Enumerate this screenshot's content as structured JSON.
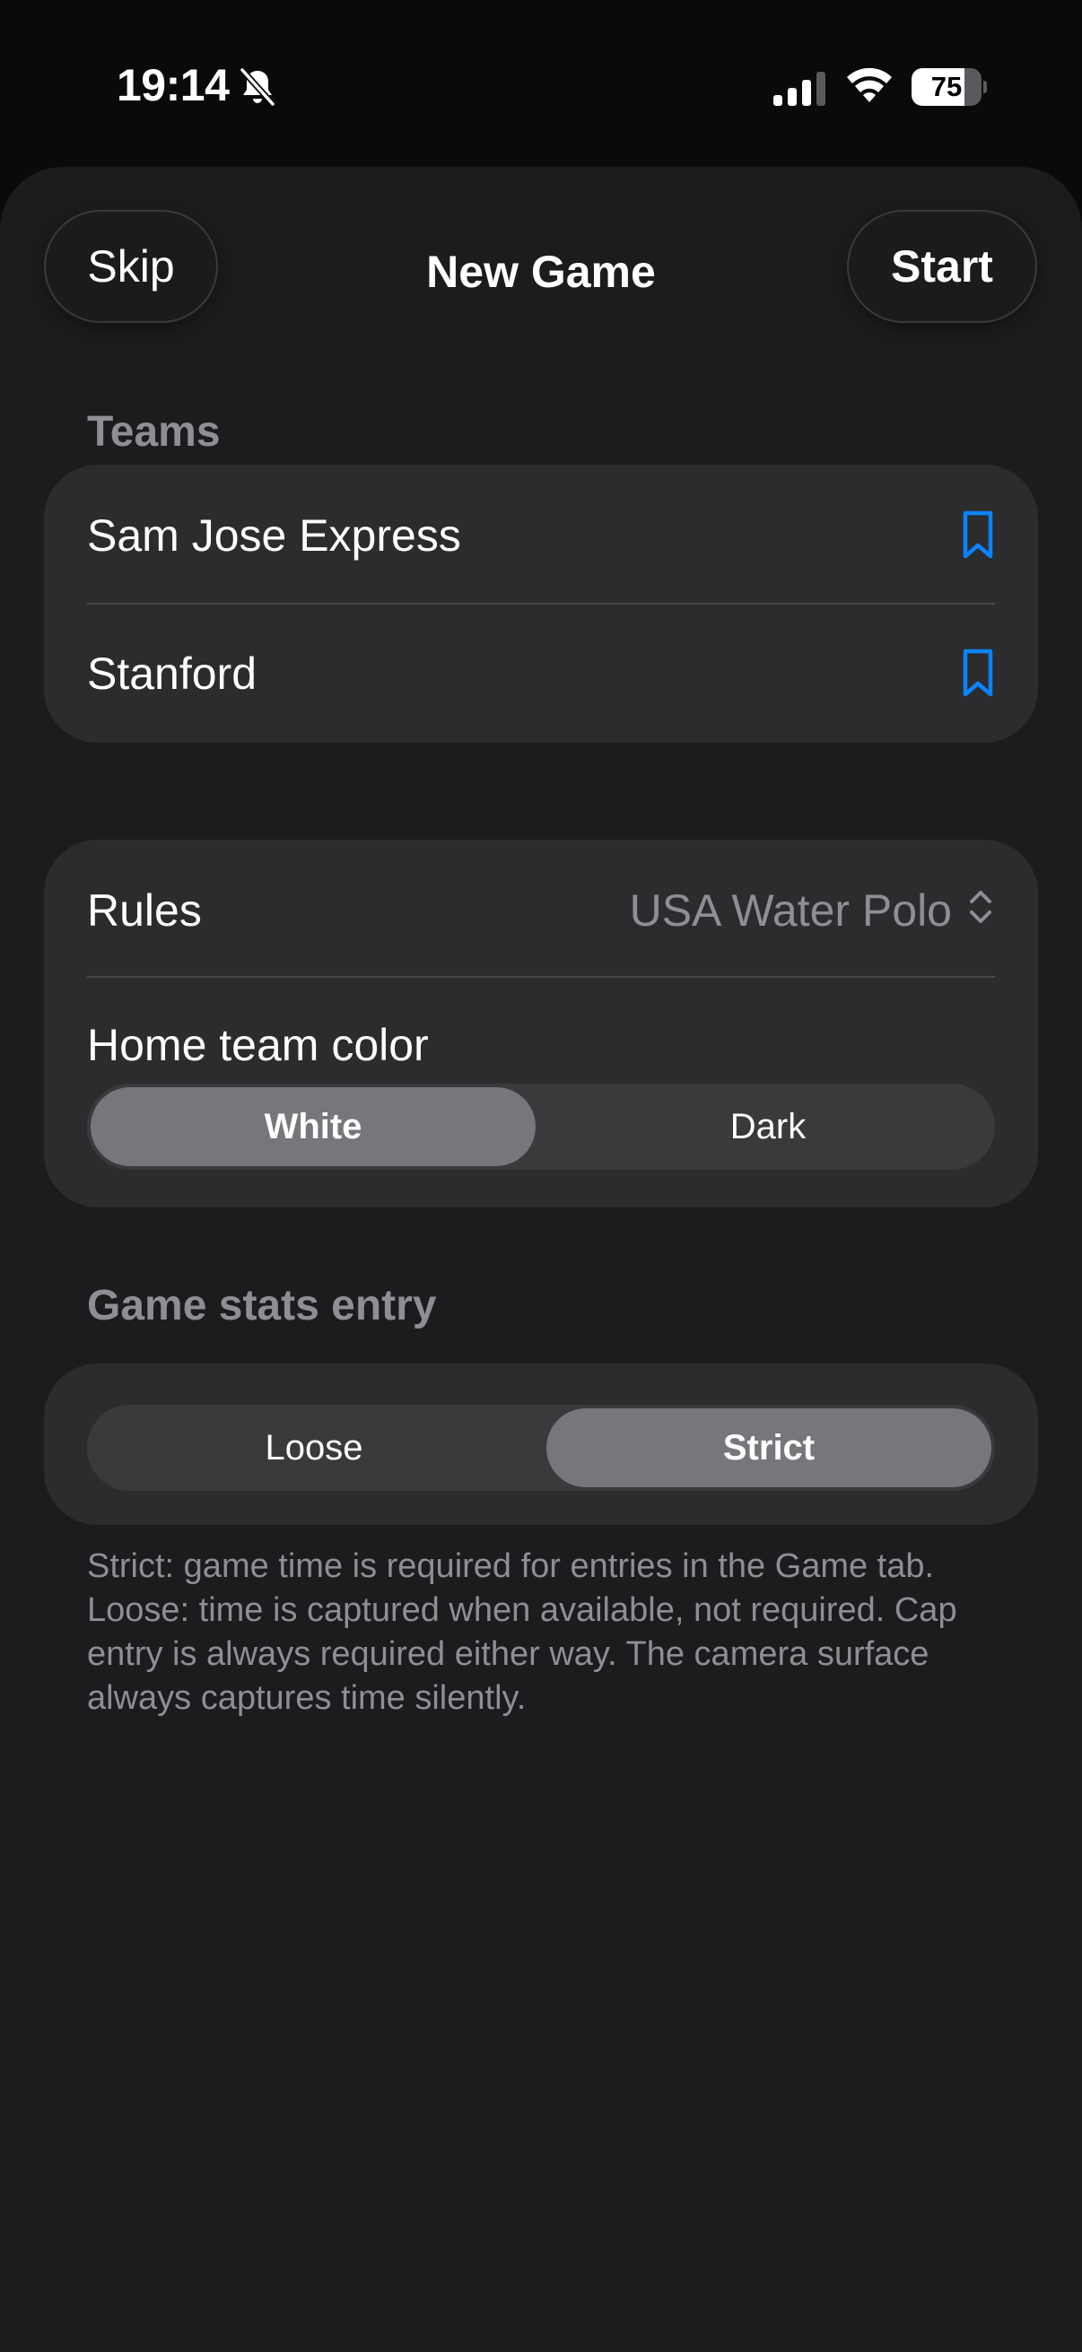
{
  "status_bar": {
    "time": "19:14",
    "battery_percent": "75",
    "battery_level": 0.75,
    "icons": [
      "bell-slash-icon",
      "cellular-signal-icon",
      "wifi-icon",
      "battery-icon"
    ]
  },
  "nav": {
    "skip_label": "Skip",
    "title": "New Game",
    "start_label": "Start"
  },
  "teams": {
    "header": "Teams",
    "items": [
      {
        "name": "Sam Jose Express",
        "icon": "bookmark-icon"
      },
      {
        "name": "Stanford",
        "icon": "bookmark-icon"
      }
    ]
  },
  "settings": {
    "rules_label": "Rules",
    "rules_value": "USA Water Polo",
    "home_color_label": "Home team color",
    "home_color_options": [
      "White",
      "Dark"
    ],
    "home_color_selected": "White"
  },
  "stats_entry": {
    "header": "Game stats entry",
    "options": [
      "Loose",
      "Strict"
    ],
    "selected": "Strict",
    "footnote": "Strict: game time is required for entries in the Game tab. Loose: time is captured when available, not required. Cap entry is always required either way. The camera surface always captures time silently."
  },
  "colors": {
    "background": "#1c1c1e",
    "card": "#2c2c2e",
    "accent_blue": "#0a84ff",
    "secondary_text": "#8e8e93",
    "segment_selected": "#76767b"
  }
}
